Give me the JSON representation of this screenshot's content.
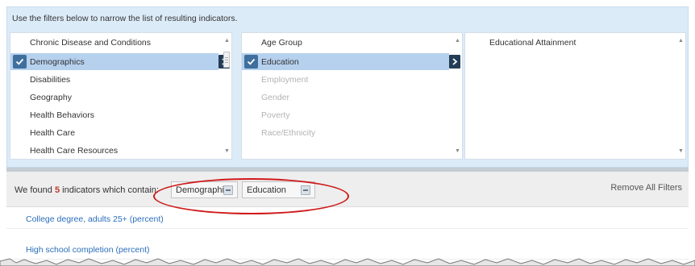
{
  "intro_text": "Use the filters below to narrow the list of resulting indicators.",
  "columns": {
    "topics": [
      {
        "label": "Chronic Disease and Conditions",
        "state": "normal"
      },
      {
        "label": "Demographics",
        "state": "selected"
      },
      {
        "label": "Disabilities",
        "state": "normal"
      },
      {
        "label": "Geography",
        "state": "normal"
      },
      {
        "label": "Health Behaviors",
        "state": "normal"
      },
      {
        "label": "Health Care",
        "state": "normal"
      },
      {
        "label": "Health Care Resources",
        "state": "normal"
      }
    ],
    "subtopics": [
      {
        "label": "Age Group",
        "state": "normal"
      },
      {
        "label": "Education",
        "state": "selected"
      },
      {
        "label": "Employment",
        "state": "disabled"
      },
      {
        "label": "Gender",
        "state": "disabled"
      },
      {
        "label": "Poverty",
        "state": "disabled"
      },
      {
        "label": "Race/Ethnicity",
        "state": "disabled"
      }
    ],
    "details": [
      {
        "label": "Educational Attainment",
        "state": "normal"
      }
    ]
  },
  "results": {
    "prefix": "We found ",
    "count": "5",
    "suffix": " indicators which contain:",
    "chips": [
      {
        "label": "Demographics"
      },
      {
        "label": "Education"
      }
    ],
    "remove_all_label": "Remove All Filters",
    "indicators": [
      "College degree, adults 25+ (percent)",
      "High school completion (percent)"
    ]
  },
  "colors": {
    "panel_bg": "#dcebf8",
    "selected_bg": "#b6d1ee",
    "check_bg": "#3f6f9c",
    "arrow_bg": "#233d57",
    "count_color": "#c0392b",
    "link_color": "#2a6ebb",
    "annotation": "#d01a1a"
  }
}
